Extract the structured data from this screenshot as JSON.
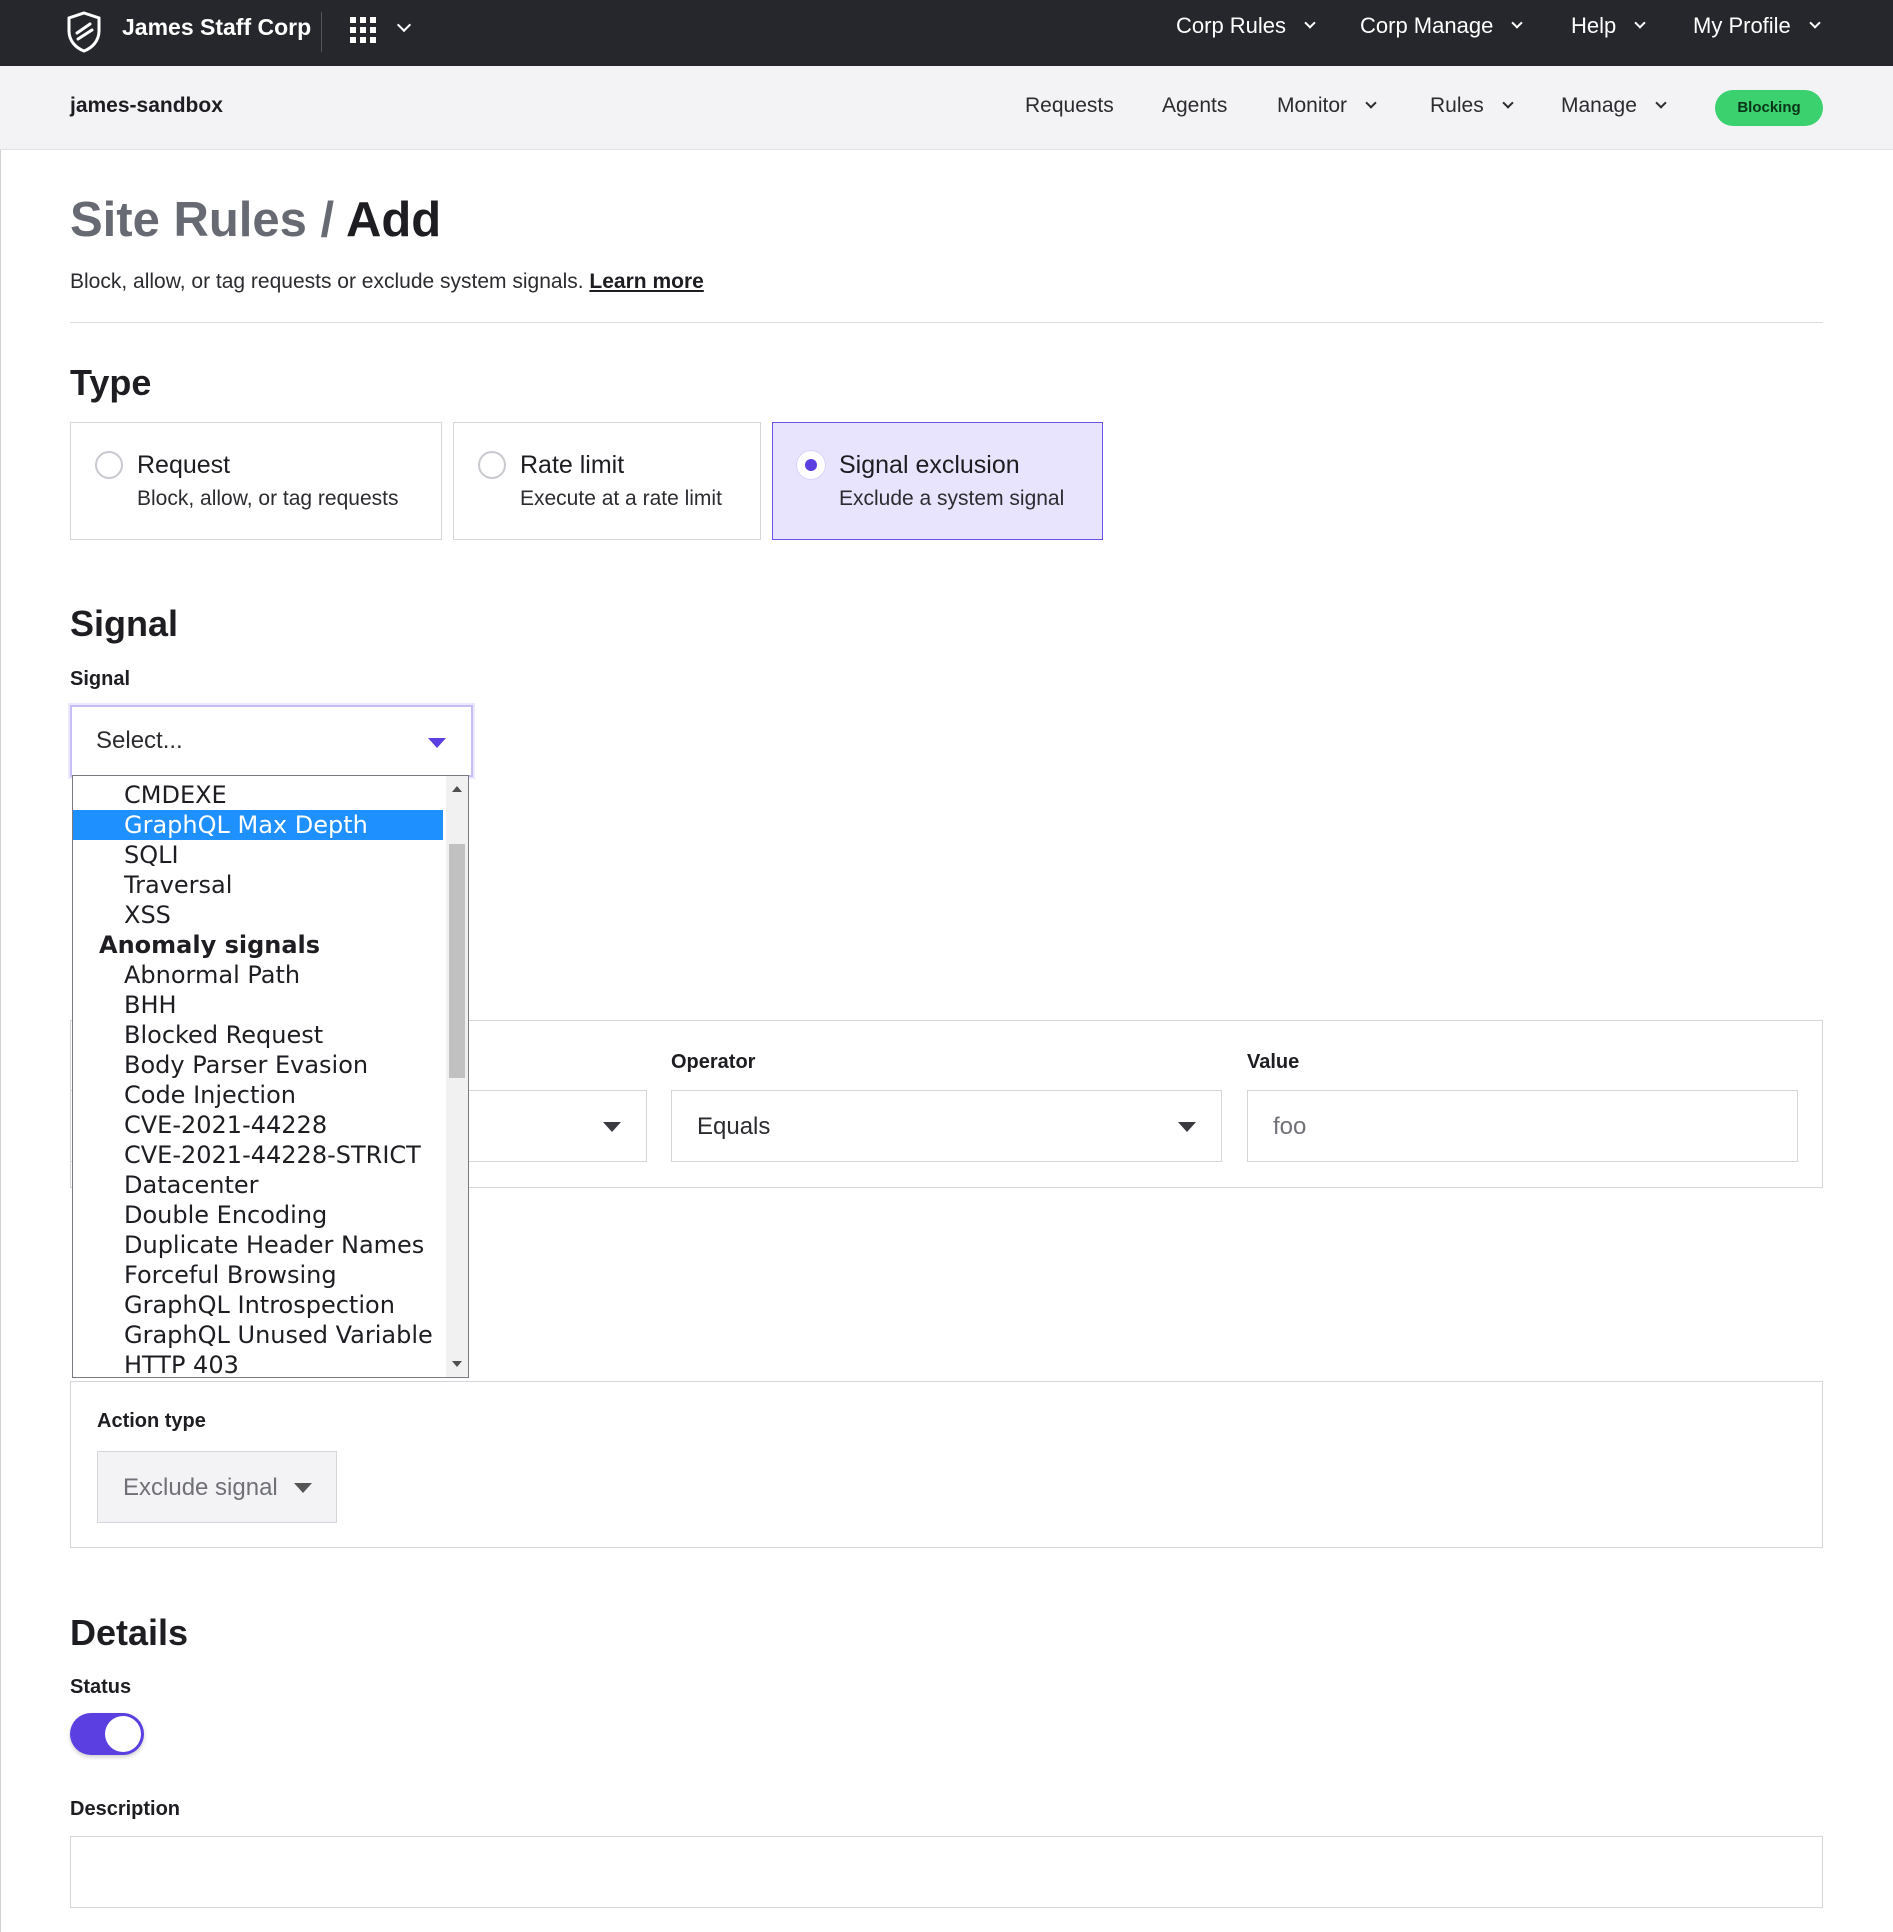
{
  "topbar": {
    "brand": "James Staff Corp",
    "nav": [
      {
        "label": "Corp Rules"
      },
      {
        "label": "Corp Manage"
      },
      {
        "label": "Help"
      },
      {
        "label": "My Profile"
      }
    ]
  },
  "subbar": {
    "site_name": "james-sandbox",
    "nav": [
      {
        "label": "Requests"
      },
      {
        "label": "Agents"
      },
      {
        "label": "Monitor"
      },
      {
        "label": "Rules"
      },
      {
        "label": "Manage"
      }
    ],
    "mode_badge": "Blocking"
  },
  "page": {
    "breadcrumb": "Site Rules",
    "separator": " / ",
    "title": "Add",
    "description": "Block, allow, or tag requests or exclude system signals.",
    "learn_more": "Learn more"
  },
  "type_section": {
    "heading": "Type",
    "options": [
      {
        "title": "Request",
        "subtitle": "Block, allow, or tag requests",
        "selected": false
      },
      {
        "title": "Rate limit",
        "subtitle": "Execute at a rate limit",
        "selected": false
      },
      {
        "title": "Signal exclusion",
        "subtitle": "Exclude a system signal",
        "selected": true
      }
    ]
  },
  "signal_section": {
    "heading": "Signal",
    "label": "Signal",
    "select_value": "Select...",
    "dropdown": {
      "highlighted": "GraphQL Max Depth",
      "items": [
        {
          "kind": "option",
          "label": "CMDEXE"
        },
        {
          "kind": "option",
          "label": "GraphQL Max Depth"
        },
        {
          "kind": "option",
          "label": "SQLI"
        },
        {
          "kind": "option",
          "label": "Traversal"
        },
        {
          "kind": "option",
          "label": "XSS"
        },
        {
          "kind": "group",
          "label": "Anomaly signals"
        },
        {
          "kind": "option",
          "label": "Abnormal Path"
        },
        {
          "kind": "option",
          "label": "BHH"
        },
        {
          "kind": "option",
          "label": "Blocked Request"
        },
        {
          "kind": "option",
          "label": "Body Parser Evasion"
        },
        {
          "kind": "option",
          "label": "Code Injection"
        },
        {
          "kind": "option",
          "label": "CVE-2021-44228"
        },
        {
          "kind": "option",
          "label": "CVE-2021-44228-STRICT"
        },
        {
          "kind": "option",
          "label": "Datacenter"
        },
        {
          "kind": "option",
          "label": "Double Encoding"
        },
        {
          "kind": "option",
          "label": "Duplicate Header Names"
        },
        {
          "kind": "option",
          "label": "Forceful Browsing"
        },
        {
          "kind": "option",
          "label": "GraphQL Introspection"
        },
        {
          "kind": "option",
          "label": "GraphQL Unused Variable"
        },
        {
          "kind": "option",
          "label": "HTTP 403"
        }
      ]
    }
  },
  "conditions": {
    "operator_label": "Operator",
    "operator_value": "Equals",
    "value_label": "Value",
    "value_placeholder": "foo"
  },
  "action": {
    "label": "Action type",
    "value": "Exclude signal"
  },
  "details": {
    "heading": "Details",
    "status_label": "Status",
    "status_on": true,
    "description_label": "Description",
    "description_value": ""
  },
  "colors": {
    "topbar_bg": "#25272d",
    "accent": "#5b3fe0",
    "badge_green": "#3bd16f",
    "highlight_blue": "#1e90ff"
  }
}
